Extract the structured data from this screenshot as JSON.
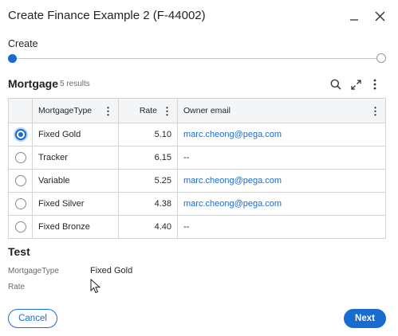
{
  "dialog": {
    "title": "Create Finance Example 2 (F-44002)"
  },
  "stepper": {
    "step_label": "Create"
  },
  "mortgage": {
    "title": "Mortgage",
    "result_count": "5 results",
    "columns": {
      "type": "MortgageType",
      "rate": "Rate",
      "email": "Owner email"
    },
    "rows": [
      {
        "type": "Fixed Gold",
        "rate": "5.10",
        "email": "marc.cheong@pega.com",
        "selected": true
      },
      {
        "type": "Tracker",
        "rate": "6.15",
        "email": "--",
        "selected": false
      },
      {
        "type": "Variable",
        "rate": "5.25",
        "email": "marc.cheong@pega.com",
        "selected": false
      },
      {
        "type": "Fixed Silver",
        "rate": "4.38",
        "email": "marc.cheong@pega.com",
        "selected": false
      },
      {
        "type": "Fixed Bronze",
        "rate": "4.40",
        "email": "--",
        "selected": false
      }
    ]
  },
  "test": {
    "title": "Test",
    "fields": [
      {
        "label": "MortgageType",
        "value": "Fixed Gold"
      },
      {
        "label": "Rate",
        "value": ""
      }
    ]
  },
  "actions": {
    "cancel_label": "Cancel",
    "next_label": "Next"
  },
  "colors": {
    "accent": "#1a6bd0",
    "text": "#1f2328",
    "header_bg": "#f4f5f7",
    "border": "#d4d4d4"
  },
  "icons": [
    "minimize-icon",
    "close-icon",
    "search-icon",
    "expand-icon",
    "more-vertical-icon",
    "column-menu-icon",
    "mouse-cursor-icon"
  ]
}
